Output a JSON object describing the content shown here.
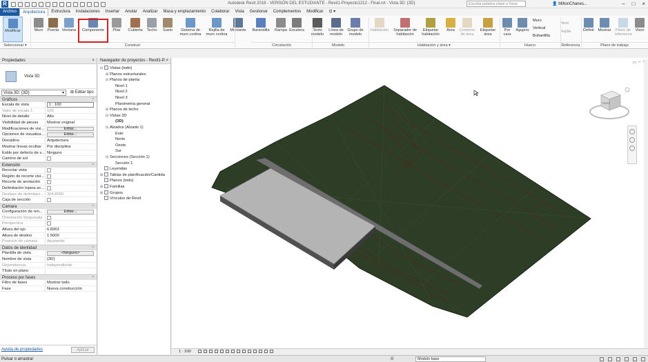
{
  "window": {
    "title": "Autodesk Revit 2018 - VERSIÓN DEL ESTUDIANTE -   Revit1-Proyecto1212 - Final.rvt - Vista 3D: {3D}",
    "search_placeholder": "Escriba palabra clave o frase",
    "user": "MiltonChanes...",
    "app_logo": "R"
  },
  "tabs": [
    "Archivo",
    "Arquitectura",
    "Estructura",
    "Instalaciones",
    "Insertar",
    "Anotar",
    "Analizar",
    "Masa y emplazamiento",
    "Colaborar",
    "Vista",
    "Gestionar",
    "Complementos",
    "Modificar"
  ],
  "active_tab": "Arquitectura",
  "ribbon": {
    "buttons": [
      {
        "label": "Modificar",
        "icon": "cursor-icon",
        "dim": false
      },
      {
        "label": "Muro",
        "icon": "wall-icon",
        "dim": false
      },
      {
        "label": "Puerta",
        "icon": "door-icon",
        "dim": false
      },
      {
        "label": "Ventana",
        "icon": "window-icon",
        "dim": false
      },
      {
        "label": "Componente",
        "icon": "component-icon",
        "dim": false
      },
      {
        "label": "Pilar",
        "icon": "column-icon",
        "dim": false
      },
      {
        "label": "Cubierta",
        "icon": "roof-icon",
        "dim": false
      },
      {
        "label": "Techo",
        "icon": "ceiling-icon",
        "dim": false
      },
      {
        "label": "Suelo",
        "icon": "floor-icon",
        "dim": false
      },
      {
        "label": "Sistema de muro cortina",
        "icon": "curtain-system-icon",
        "dim": false
      },
      {
        "label": "Rejilla de muro cortina",
        "icon": "curtain-grid-icon",
        "dim": false
      },
      {
        "label": "Montante",
        "icon": "mullion-icon",
        "dim": false
      },
      {
        "label": "Barandilla",
        "icon": "railing-icon",
        "dim": false
      },
      {
        "label": "Rampa",
        "icon": "ramp-icon",
        "dim": false
      },
      {
        "label": "Escalera",
        "icon": "stair-icon",
        "dim": false
      },
      {
        "label": "Texto modelo",
        "icon": "model-text-icon",
        "dim": false
      },
      {
        "label": "Línea de modelo",
        "icon": "model-line-icon",
        "dim": false
      },
      {
        "label": "Grupo de modelo",
        "icon": "model-group-icon",
        "dim": false
      },
      {
        "label": "Habitación",
        "icon": "room-icon",
        "dim": true
      },
      {
        "label": "Separador de habitación",
        "icon": "room-separator-icon",
        "dim": false
      },
      {
        "label": "Etiquetar habitación",
        "icon": "tag-room-icon",
        "dim": false
      },
      {
        "label": "Área",
        "icon": "area-icon",
        "dim": false
      },
      {
        "label": "Contorno de área",
        "icon": "area-boundary-icon",
        "dim": true
      },
      {
        "label": "Etiquetar área",
        "icon": "tag-area-icon",
        "dim": false
      },
      {
        "label": "Por cara",
        "icon": "by-face-icon",
        "dim": false
      },
      {
        "label": "Agujero",
        "icon": "shaft-icon",
        "dim": false
      },
      {
        "label": "Definir",
        "icon": "set-workplane-icon",
        "dim": false
      },
      {
        "label": "Mostrar",
        "icon": "show-workplane-icon",
        "dim": false
      },
      {
        "label": "Plano de referencia",
        "icon": "ref-plane-icon",
        "dim": true
      },
      {
        "label": "Visor",
        "icon": "viewer-icon",
        "dim": false
      }
    ],
    "mini": {
      "muro": "Muro",
      "vertical": "Vertical",
      "buhardilla": "Buhardilla",
      "nivel": "Nivel",
      "rejilla": "Rejilla"
    },
    "panels": [
      "Seleccionar ▾",
      "Construir",
      "Circulación",
      "Modelo",
      "Habitación y área ▾",
      "Hueco",
      "Referencia",
      "Plano de trabajo"
    ]
  },
  "properties": {
    "title": "Propiedades",
    "type_name": "Vista 3D",
    "view_selector": "Vista 3D: {3D}",
    "edit_type": "Editar tipo",
    "sections": [
      {
        "name": "Gráficos",
        "rows": [
          {
            "k": "Escala de vista",
            "v": "1 : 100",
            "kind": "input"
          },
          {
            "k": "Valor de escala    1:",
            "v": "100",
            "kind": "dim"
          },
          {
            "k": "Nivel de detalle",
            "v": "Alto",
            "kind": "text"
          },
          {
            "k": "Visibilidad de piezas",
            "v": "Mostrar original",
            "kind": "text"
          },
          {
            "k": "Modificaciones de visi...",
            "v": "Editar...",
            "kind": "button"
          },
          {
            "k": "Opciones de visualiza...",
            "v": "Editar...",
            "kind": "button"
          },
          {
            "k": "Disciplina",
            "v": "Arquitectura",
            "kind": "text"
          },
          {
            "k": "Mostrar líneas ocultas",
            "v": "Por disciplina",
            "kind": "text"
          },
          {
            "k": "Estilo por defecto de v...",
            "v": "Ninguno",
            "kind": "text"
          },
          {
            "k": "Camino de sol",
            "v": "",
            "kind": "check"
          }
        ]
      },
      {
        "name": "Extensión",
        "rows": [
          {
            "k": "Recortar vista",
            "v": "",
            "kind": "check"
          },
          {
            "k": "Región de recorte visi...",
            "v": "",
            "kind": "check"
          },
          {
            "k": "Recorte de anotación",
            "v": "",
            "kind": "check"
          },
          {
            "k": "Delimitación lejana ac...",
            "v": "",
            "kind": "check"
          },
          {
            "k": "Desfase de delimitaci...",
            "v": "304.8000",
            "kind": "dim"
          },
          {
            "k": "Caja de sección",
            "v": "",
            "kind": "check"
          }
        ]
      },
      {
        "name": "Cámara",
        "rows": [
          {
            "k": "Configuración de ren...",
            "v": "Editar...",
            "kind": "button"
          },
          {
            "k": "Orientación bloqueada",
            "v": "",
            "kind": "dimcheck"
          },
          {
            "k": "Perspectiva",
            "v": "",
            "kind": "dimcheck"
          },
          {
            "k": "Altura del ojo",
            "v": "6.8363",
            "kind": "text"
          },
          {
            "k": "Altura de destino",
            "v": "1.5000",
            "kind": "text"
          },
          {
            "k": "Posición de cámara",
            "v": "Ajustando",
            "kind": "dim"
          }
        ]
      },
      {
        "name": "Datos de identidad",
        "rows": [
          {
            "k": "Plantilla de vista",
            "v": "<Ninguno>",
            "kind": "button"
          },
          {
            "k": "Nombre de vista",
            "v": "{3D}",
            "kind": "text"
          },
          {
            "k": "Dependencia",
            "v": "Independiente",
            "kind": "dim"
          },
          {
            "k": "Título en plano",
            "v": "",
            "kind": "text"
          }
        ]
      },
      {
        "name": "Proceso por fases",
        "rows": [
          {
            "k": "Filtro de fases",
            "v": "Mostrar todo",
            "kind": "text"
          },
          {
            "k": "Fase",
            "v": "Nueva construcción",
            "kind": "text"
          }
        ]
      }
    ],
    "help_link": "Ayuda de propiedades",
    "apply": "Aplicar"
  },
  "browser": {
    "title": "Navegador de proyectos - Revit1-P...",
    "nodes": [
      {
        "text": "Vistas (todo)",
        "depth": 0,
        "tg": "⊟",
        "bold": false
      },
      {
        "text": "Planos estructurales",
        "depth": 1,
        "tg": "⊞",
        "bold": false
      },
      {
        "text": "Planos de planta",
        "depth": 1,
        "tg": "⊟",
        "bold": false
      },
      {
        "text": "Nivel 1",
        "depth": 2,
        "tg": "",
        "bold": false
      },
      {
        "text": "Nivel 2",
        "depth": 2,
        "tg": "",
        "bold": false
      },
      {
        "text": "Nivel 3",
        "depth": 2,
        "tg": "",
        "bold": false
      },
      {
        "text": "Planimetría general",
        "depth": 2,
        "tg": "",
        "bold": false
      },
      {
        "text": "Planos de techo",
        "depth": 1,
        "tg": "⊞",
        "bold": false
      },
      {
        "text": "Vistas 3D",
        "depth": 1,
        "tg": "⊟",
        "bold": false
      },
      {
        "text": "{3D}",
        "depth": 2,
        "tg": "",
        "bold": true
      },
      {
        "text": "Alzados (Alzado 1)",
        "depth": 1,
        "tg": "⊟",
        "bold": false
      },
      {
        "text": "Este",
        "depth": 2,
        "tg": "",
        "bold": false
      },
      {
        "text": "Norte",
        "depth": 2,
        "tg": "",
        "bold": false
      },
      {
        "text": "Oeste",
        "depth": 2,
        "tg": "",
        "bold": false
      },
      {
        "text": "Sur",
        "depth": 2,
        "tg": "",
        "bold": false
      },
      {
        "text": "Secciones (Sección 1)",
        "depth": 1,
        "tg": "⊟",
        "bold": false
      },
      {
        "text": "Sección 1",
        "depth": 2,
        "tg": "",
        "bold": false
      },
      {
        "text": "Leyendas",
        "depth": 0,
        "tg": "",
        "bold": false
      },
      {
        "text": "Tablas de planificación/Cantida",
        "depth": 0,
        "tg": "⊞",
        "bold": false
      },
      {
        "text": "Planos (todo)",
        "depth": 0,
        "tg": "",
        "bold": false
      },
      {
        "text": "Familias",
        "depth": 0,
        "tg": "⊞",
        "bold": false
      },
      {
        "text": "Grupos",
        "depth": 0,
        "tg": "⊞",
        "bold": false
      },
      {
        "text": "Vínculos de Revit",
        "depth": 0,
        "tg": "",
        "bold": false
      }
    ]
  },
  "viewport": {
    "viewcube_face": "FRONT"
  },
  "view_control": {
    "scale": "1 : 100"
  },
  "status": {
    "prompt": "Pulsar o arrastrar",
    "zero": ":0",
    "model": "Modelo base"
  },
  "colors": {
    "accent": "#1a5aa0",
    "terrain": "#2e3e26",
    "building": "#b4b4b4",
    "highlight": "#d32020"
  }
}
